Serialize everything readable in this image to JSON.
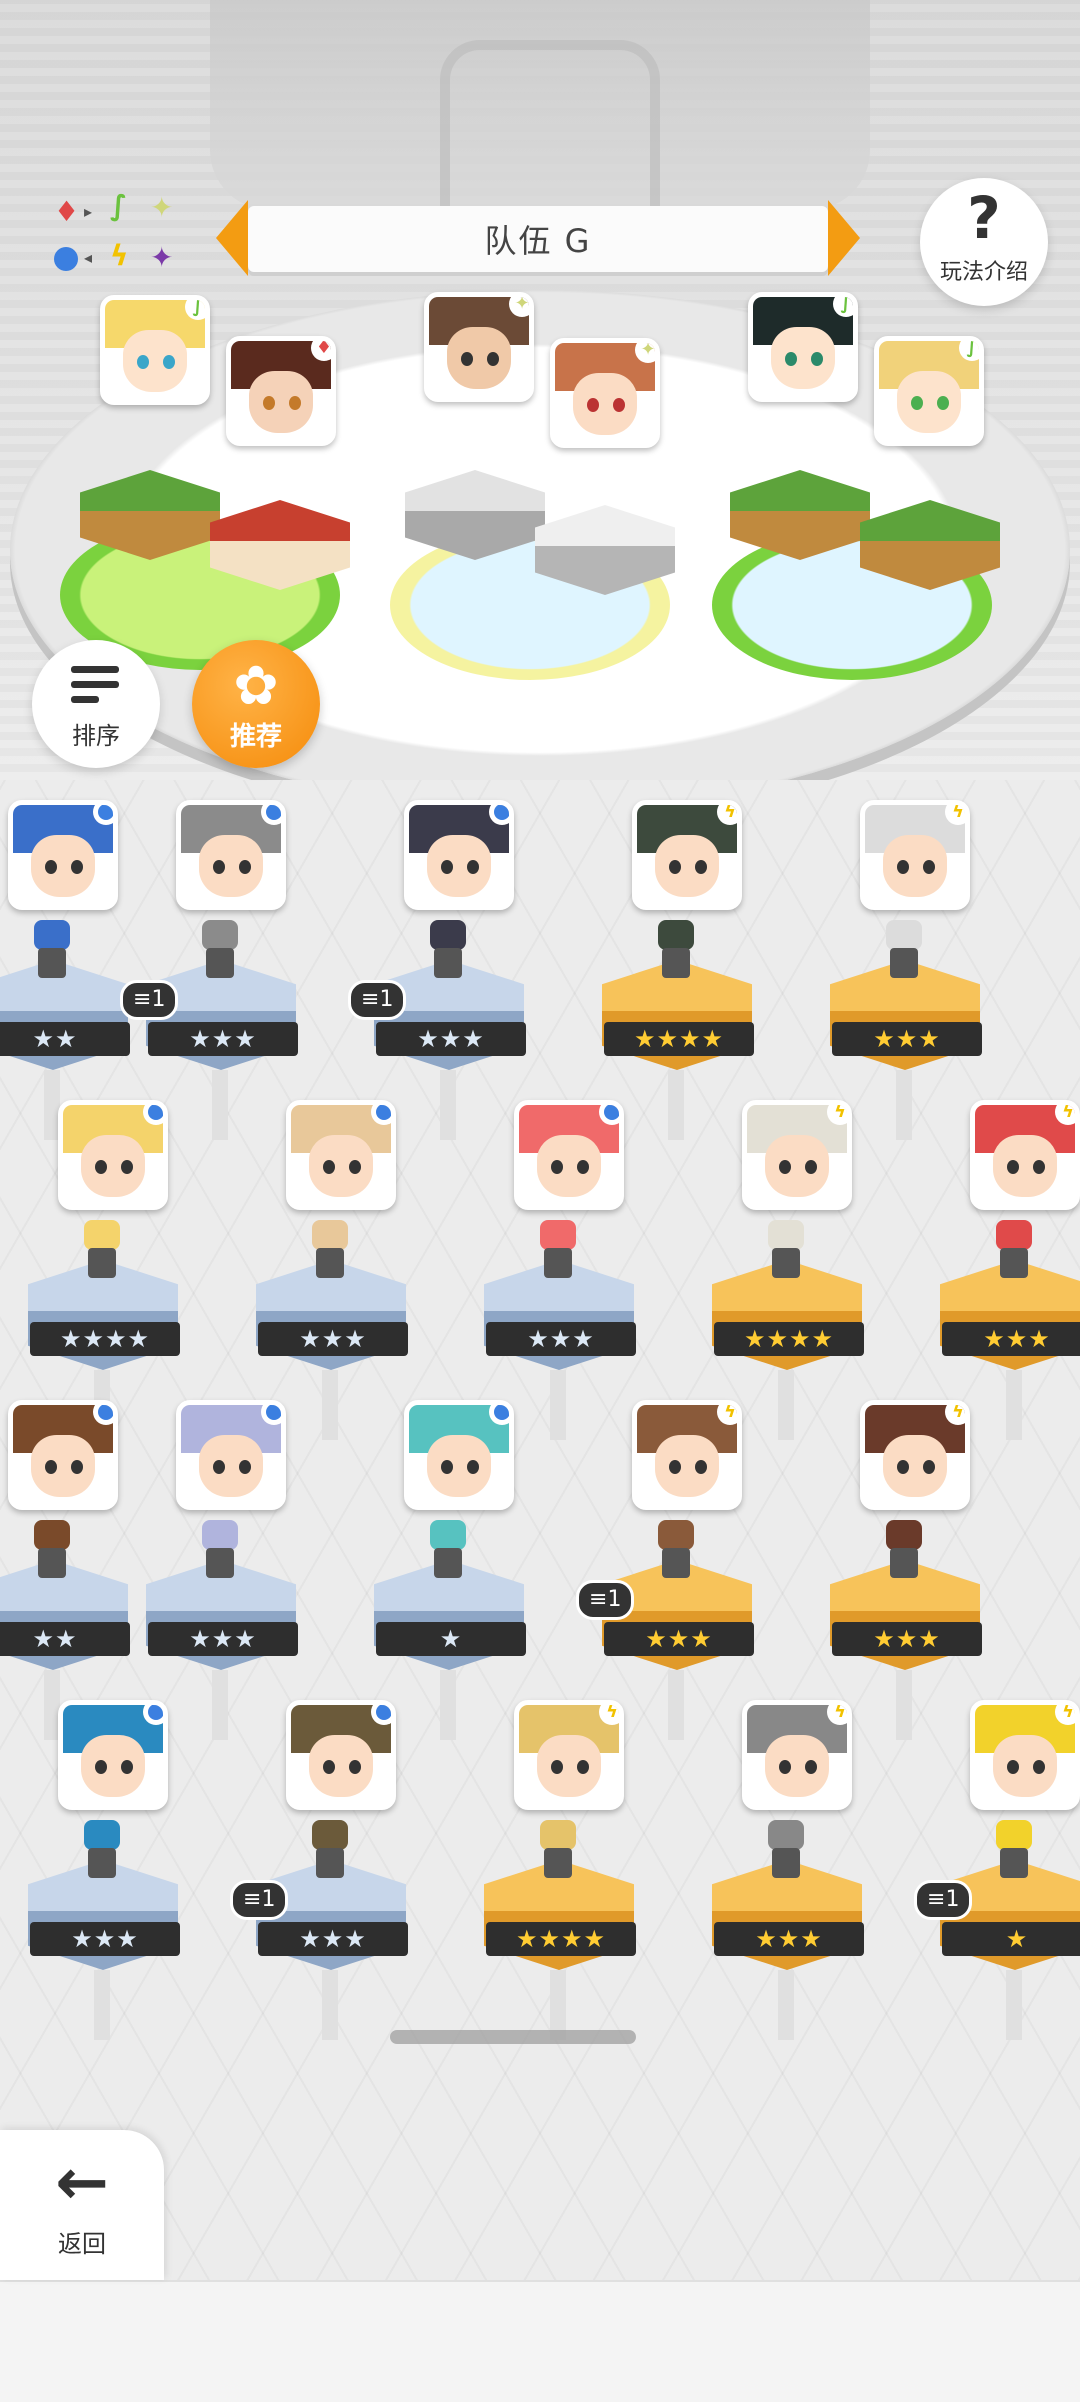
{
  "header": {
    "team_title": "队伍 G",
    "help_label": "玩法介绍",
    "sort_label": "排序",
    "recommend_label": "推荐"
  },
  "element_chart": {
    "items": [
      "fire-diamond",
      "leaf",
      "spark-star",
      "water-dot",
      "bolt",
      "dark-star"
    ],
    "colors": {
      "fire": "#e04848",
      "leaf": "#6bc23e",
      "spark": "#cfd67a",
      "water": "#3b7fe0",
      "bolt": "#f2c200",
      "dark": "#7b3aa8"
    }
  },
  "team": [
    {
      "slot": 1,
      "element": "leaf",
      "element_glyph": "∫"
    },
    {
      "slot": 2,
      "element": "fire",
      "element_glyph": "♦"
    },
    {
      "slot": 3,
      "element": "spark",
      "element_glyph": "✦"
    },
    {
      "slot": 4,
      "element": "spark",
      "element_glyph": "✦"
    },
    {
      "slot": 5,
      "element": "leaf",
      "element_glyph": "∫"
    },
    {
      "slot": 6,
      "element": "leaf",
      "element_glyph": "∫"
    }
  ],
  "roster": {
    "rows": [
      [
        {
          "stars": "★★",
          "element": "water",
          "tier": "silver",
          "dup": ""
        },
        {
          "stars": "★★★",
          "element": "water",
          "tier": "silver",
          "dup": "1"
        },
        {
          "stars": "★★★",
          "element": "water",
          "tier": "silver",
          "dup": "1"
        },
        {
          "stars": "★★★★",
          "element": "bolt",
          "tier": "gold",
          "dup": ""
        },
        {
          "stars": "★★★",
          "element": "bolt",
          "tier": "gold",
          "dup": ""
        }
      ],
      [
        {
          "stars": "★★★★",
          "element": "water",
          "tier": "silver",
          "dup": ""
        },
        {
          "stars": "★★★",
          "element": "water",
          "tier": "silver",
          "dup": ""
        },
        {
          "stars": "★★★",
          "element": "water",
          "tier": "silver",
          "dup": ""
        },
        {
          "stars": "★★★★",
          "element": "bolt",
          "tier": "gold",
          "dup": ""
        },
        {
          "stars": "★★★",
          "element": "bolt",
          "tier": "gold",
          "dup": ""
        }
      ],
      [
        {
          "stars": "★★",
          "element": "water",
          "tier": "silver",
          "dup": ""
        },
        {
          "stars": "★★★",
          "element": "water",
          "tier": "silver",
          "dup": ""
        },
        {
          "stars": "★",
          "element": "water",
          "tier": "silver",
          "dup": ""
        },
        {
          "stars": "★★★",
          "element": "bolt",
          "tier": "gold",
          "dup": "1"
        },
        {
          "stars": "★★★",
          "element": "bolt",
          "tier": "gold",
          "dup": ""
        }
      ],
      [
        {
          "stars": "★★★",
          "element": "water",
          "tier": "silver",
          "dup": ""
        },
        {
          "stars": "★★★",
          "element": "water",
          "tier": "silver",
          "dup": "1"
        },
        {
          "stars": "★★★★",
          "element": "bolt",
          "tier": "gold",
          "dup": ""
        },
        {
          "stars": "★★★",
          "element": "bolt",
          "tier": "gold",
          "dup": ""
        },
        {
          "stars": "★",
          "element": "bolt",
          "tier": "gold",
          "dup": "1"
        }
      ]
    ]
  },
  "footer": {
    "back_label": "返回"
  },
  "icons": {
    "help": "question-mark-icon",
    "sort": "sort-lines-icon",
    "recommend": "flower-icon",
    "back": "arrow-left-icon",
    "duplicate": "stack-icon"
  }
}
